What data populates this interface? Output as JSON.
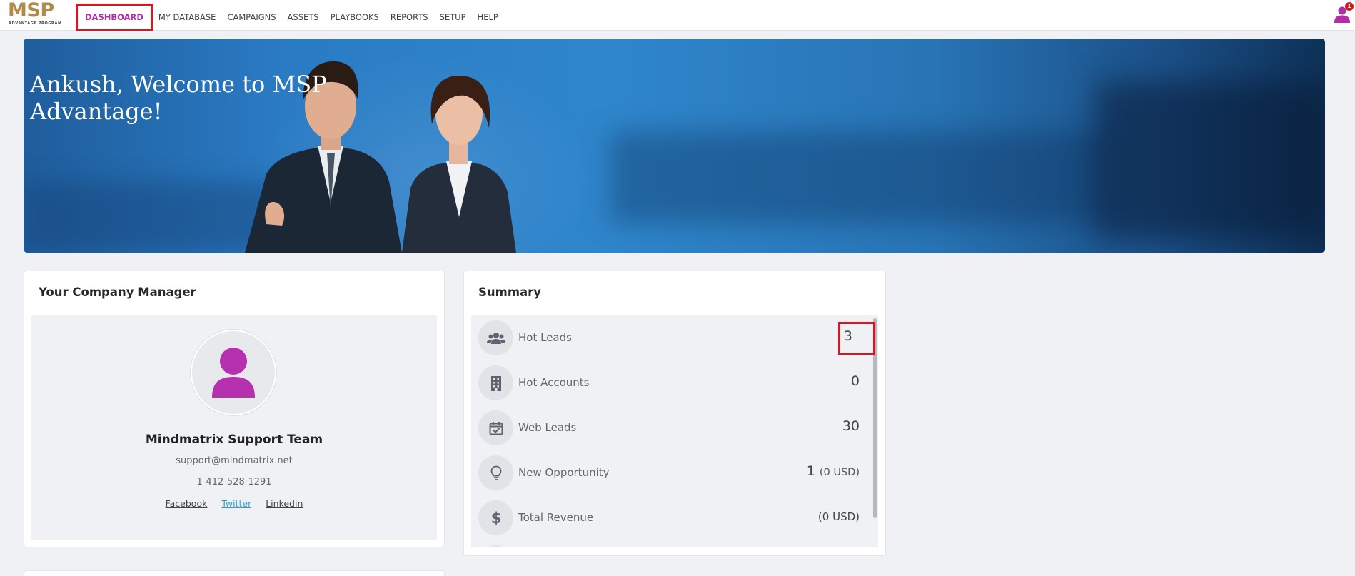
{
  "brand": {
    "logo_text": "MSP",
    "logo_sub": "ADVANTAGE PROGRAM"
  },
  "nav": {
    "items": [
      {
        "label": "DASHBOARD",
        "active": true
      },
      {
        "label": "MY DATABASE"
      },
      {
        "label": "CAMPAIGNS"
      },
      {
        "label": "ASSETS"
      },
      {
        "label": "PLAYBOOKS"
      },
      {
        "label": "REPORTS"
      },
      {
        "label": "SETUP"
      },
      {
        "label": "HELP"
      }
    ],
    "notification_count": "1"
  },
  "hero": {
    "title": "Ankush, Welcome to MSP Advantage!"
  },
  "manager": {
    "title": "Your Company Manager",
    "name": "Mindmatrix Support Team",
    "email": "support@mindmatrix.net",
    "phone": "1-412-528-1291",
    "links": {
      "facebook": "Facebook",
      "twitter": "Twitter",
      "linkedin": "Linkedin"
    }
  },
  "summary": {
    "title": "Summary",
    "rows": [
      {
        "icon": "users-icon",
        "label": "Hot Leads",
        "value": "3",
        "sub": ""
      },
      {
        "icon": "building-icon",
        "label": "Hot Accounts",
        "value": "0",
        "sub": ""
      },
      {
        "icon": "calendar-check-icon",
        "label": "Web Leads",
        "value": "30",
        "sub": ""
      },
      {
        "icon": "lightbulb-icon",
        "label": "New Opportunity",
        "value": "1",
        "sub": "(0 USD)"
      },
      {
        "icon": "dollar-icon",
        "label": "Total Revenue",
        "value": "",
        "sub": "(0 USD)"
      }
    ]
  },
  "colors": {
    "accent": "#b02ea7",
    "highlight": "#d5181f",
    "brand_gold": "#b28a48",
    "link_twitter": "#2aa3c9"
  }
}
